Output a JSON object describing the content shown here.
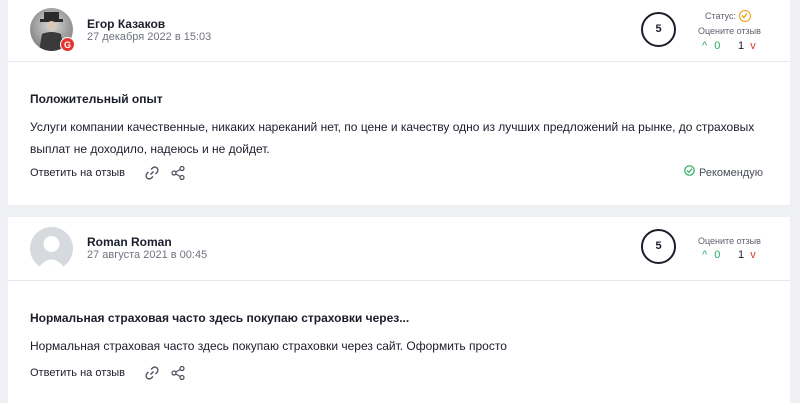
{
  "reviews": [
    {
      "author": "Егор Казаков",
      "date": "27 декабря 2022 в 15:03",
      "badge": "G",
      "score": "5",
      "status_label": "Статус:",
      "rate_label": "Оцените отзыв",
      "likes": "0",
      "dislikes": "1",
      "title": "Положительный опыт",
      "text": "Услуги компании качественные, никаких нареканий нет, по цене и качеству одно из лучших предложений на рынке, до страховых выплат не доходило, надеюсь и не дойдет.",
      "reply_label": "Ответить на отзыв",
      "recommend_label": "Рекомендую"
    },
    {
      "author": "Roman Roman",
      "date": "27 августа 2021 в 00:45",
      "score": "5",
      "rate_label": "Оцените отзыв",
      "likes": "0",
      "dislikes": "1",
      "title": "Нормальная страховая часто здесь покупаю страховки через...",
      "text": "Нормальная страховая часто здесь покупаю страховки через сайт. Оформить просто",
      "reply_label": "Ответить на отзыв"
    }
  ],
  "colors": {
    "accent_green": "#27ae60",
    "accent_red": "#e3342f",
    "status_orange": "#f39c12"
  },
  "icons": [
    "link-icon",
    "share-icon",
    "arrow-up-icon",
    "arrow-down-icon",
    "check-circle-icon",
    "google-badge-icon"
  ]
}
